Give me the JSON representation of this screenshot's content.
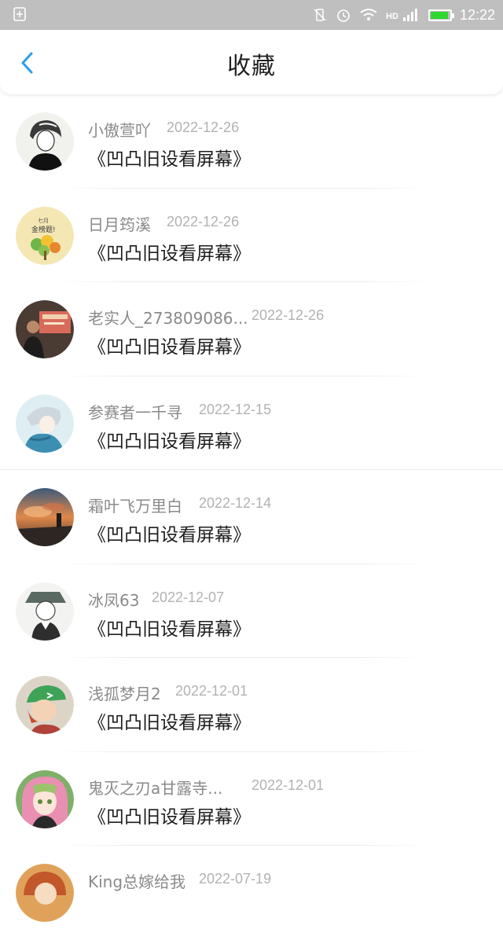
{
  "status_bar": {
    "time": "12:22",
    "battery_color": "#2fd82f"
  },
  "header": {
    "title": "收藏"
  },
  "items": [
    {
      "username": "小傲萱吖",
      "date": "2022-12-26",
      "title": "《凹凸旧设看屏幕》"
    },
    {
      "username": "日月筠溪",
      "date": "2022-12-26",
      "title": "《凹凸旧设看屏幕》"
    },
    {
      "username": "老实人_273809086...",
      "date": "2022-12-26",
      "title": "《凹凸旧设看屏幕》"
    },
    {
      "username": "参赛者一千寻",
      "date": "2022-12-15",
      "title": "《凹凸旧设看屏幕》"
    },
    {
      "username": "霜叶飞万里白",
      "date": "2022-12-14",
      "title": "《凹凸旧设看屏幕》"
    },
    {
      "username": "冰凤63",
      "date": "2022-12-07",
      "title": "《凹凸旧设看屏幕》"
    },
    {
      "username": "浅孤梦月2",
      "date": "2022-12-01",
      "title": "《凹凸旧设看屏幕》"
    },
    {
      "username": "鬼灭之刃a甘露寺...",
      "date": "2022-12-01",
      "title": "《凹凸旧设看屏幕》"
    },
    {
      "username": "King总嫁给我",
      "date": "2022-07-19",
      "title": ""
    }
  ]
}
